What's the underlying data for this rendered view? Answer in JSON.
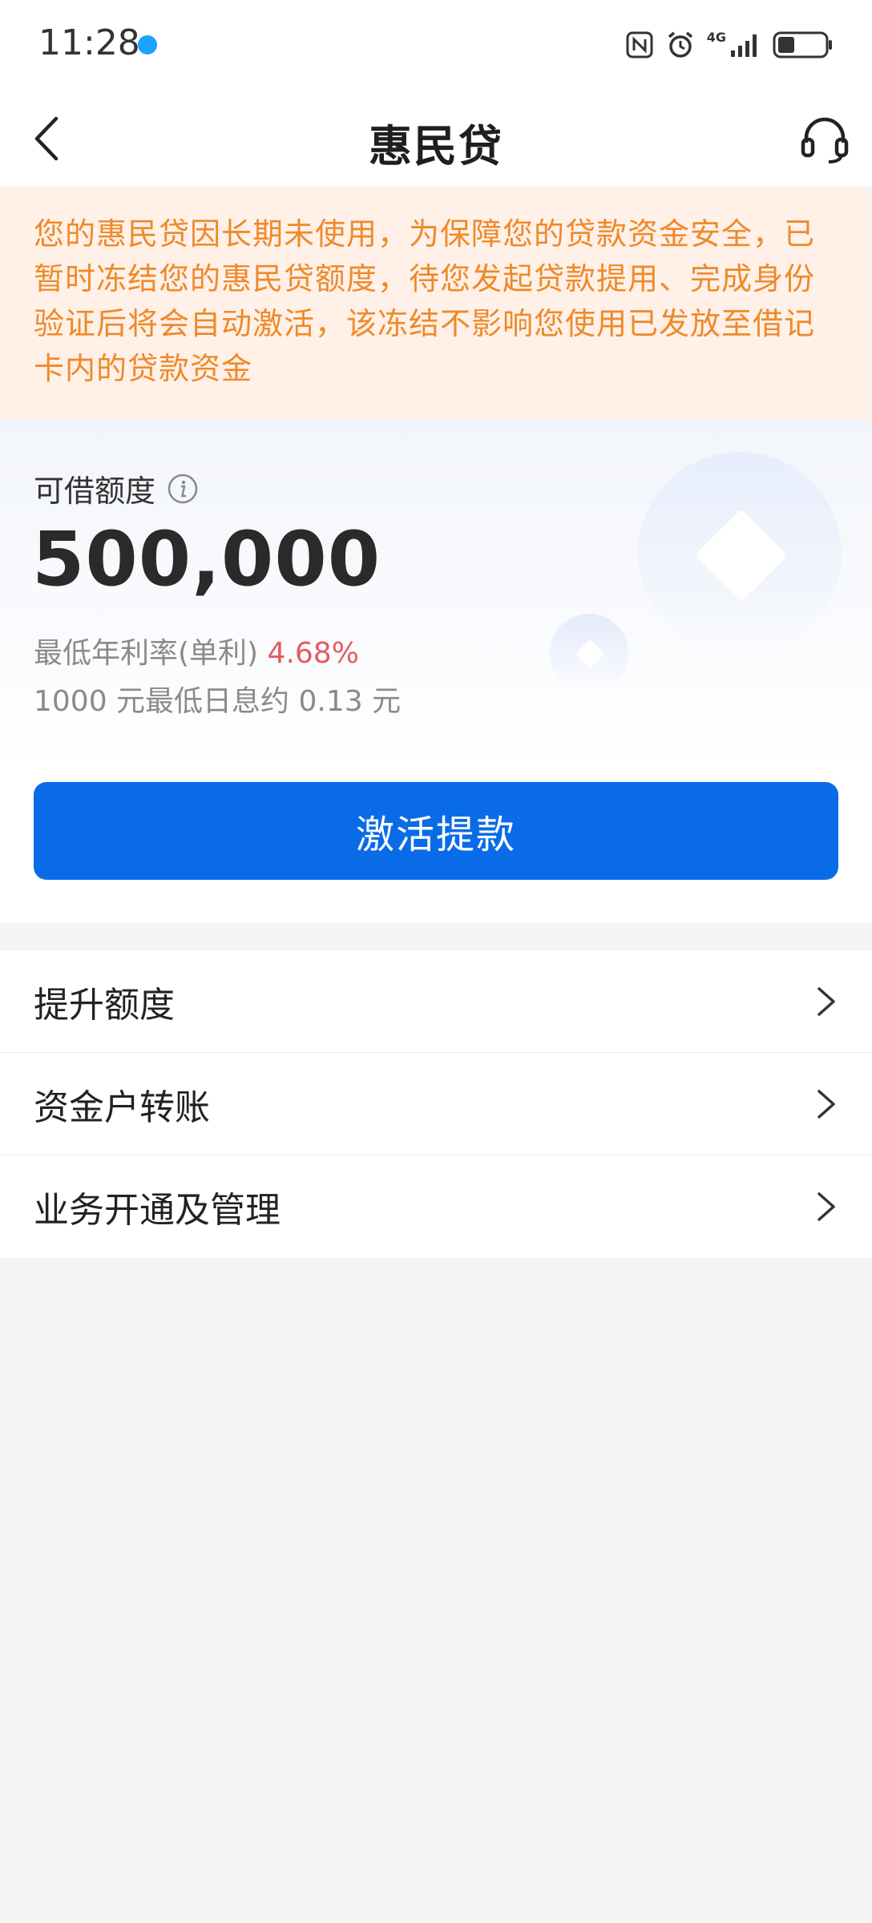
{
  "status_bar": {
    "time": "11:28",
    "network_label": "4G",
    "battery_level": 0.35
  },
  "nav": {
    "title": "惠民贷",
    "back_icon": "chevron-left-icon",
    "service_icon": "headset-icon"
  },
  "notice": {
    "text": "您的惠民贷因长期未使用，为保障您的贷款资金安全，已暂时冻结您的惠民贷额度，待您发起贷款提用、完成身份验证后将会自动激活，该冻结不影响您使用已发放至借记卡内的贷款资金"
  },
  "quota": {
    "label": "可借额度",
    "amount": "500,000",
    "rate_label": "最低年利率(单利) ",
    "rate_value": "4.68%",
    "daily_interest": "1000 元最低日息约 0.13 元",
    "activate_button": "激活提款"
  },
  "menu": {
    "items": [
      {
        "label": "提升额度"
      },
      {
        "label": "资金户转账"
      },
      {
        "label": "业务开通及管理"
      }
    ]
  },
  "colors": {
    "accent": "#0a6be8",
    "notice_text": "#ee8a2a",
    "notice_bg": "#fff0e8",
    "rate_highlight": "#e35d5d"
  }
}
